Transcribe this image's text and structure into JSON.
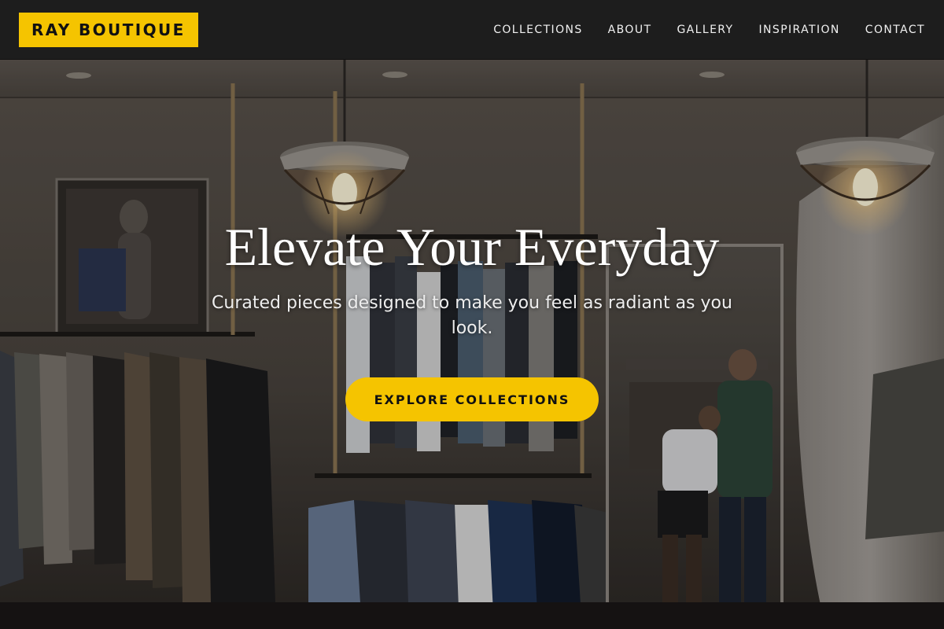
{
  "nav": {
    "brand": "RAY BOUTIQUE",
    "links": [
      "COLLECTIONS",
      "ABOUT",
      "GALLERY",
      "INSPIRATION",
      "CONTACT"
    ]
  },
  "hero": {
    "title": "Elevate Your Everyday",
    "subtitle": "Curated pieces designed to make you feel as radiant as you look.",
    "cta_label": "EXPLORE COLLECTIONS",
    "background_description_icon": "boutique-interior-photo"
  },
  "colors": {
    "accent": "#f5c400",
    "nav_bg": "#1d1d1d",
    "text_light": "#ffffff"
  }
}
